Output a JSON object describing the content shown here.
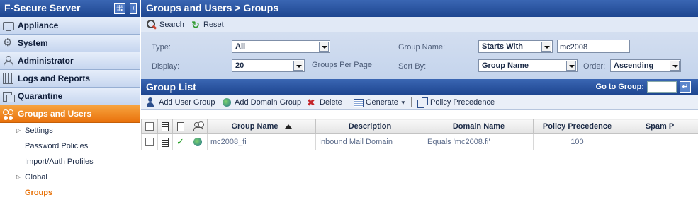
{
  "app": {
    "title": "F-Secure Server"
  },
  "nav": {
    "items": [
      {
        "label": "Appliance",
        "icon": "appliance-icon"
      },
      {
        "label": "System",
        "icon": "system-tools-icon"
      },
      {
        "label": "Administrator",
        "icon": "administrator-icon"
      },
      {
        "label": "Logs and Reports",
        "icon": "logs-reports-icon"
      },
      {
        "label": "Quarantine",
        "icon": "quarantine-icon"
      },
      {
        "label": "Groups and Users",
        "icon": "groups-users-icon",
        "active": true
      }
    ],
    "sub_items": [
      {
        "label": "Settings",
        "expandable": true
      },
      {
        "label": "Password Policies"
      },
      {
        "label": "Import/Auth Profiles"
      },
      {
        "label": "Global",
        "expandable": true
      },
      {
        "label": "Groups",
        "current": true
      }
    ]
  },
  "breadcrumb": "Groups and Users > Groups",
  "toolbar": {
    "search": "Search",
    "reset": "Reset"
  },
  "filter": {
    "type_label": "Type:",
    "type_value": "All",
    "display_label": "Display:",
    "display_value": "20",
    "per_page_label": "Groups Per Page",
    "group_name_label": "Group Name:",
    "match_mode": "Starts With",
    "group_name_value": "mc2008",
    "sort_by_label": "Sort By:",
    "sort_by_value": "Group Name",
    "order_label": "Order:",
    "order_value": "Ascending"
  },
  "group_list": {
    "title": "Group List",
    "goto_label": "Go to Group:",
    "goto_value": "",
    "actions": {
      "add_user_group": "Add User Group",
      "add_domain_group": "Add Domain Group",
      "delete": "Delete",
      "generate": "Generate",
      "policy_precedence": "Policy Precedence"
    },
    "columns": [
      "Group Name",
      "Description",
      "Domain Name",
      "Policy Precedence",
      "Spam P"
    ],
    "rows": [
      {
        "group_name": "mc2008_fi",
        "description": "Inbound Mail Domain",
        "domain_name": "Equals 'mc2008.fi'",
        "policy_precedence": "100",
        "spam": ""
      }
    ]
  },
  "colors": {
    "header_blue": "#1e4690",
    "active_orange": "#e9720c",
    "panel_blue": "#c4d4ec"
  }
}
